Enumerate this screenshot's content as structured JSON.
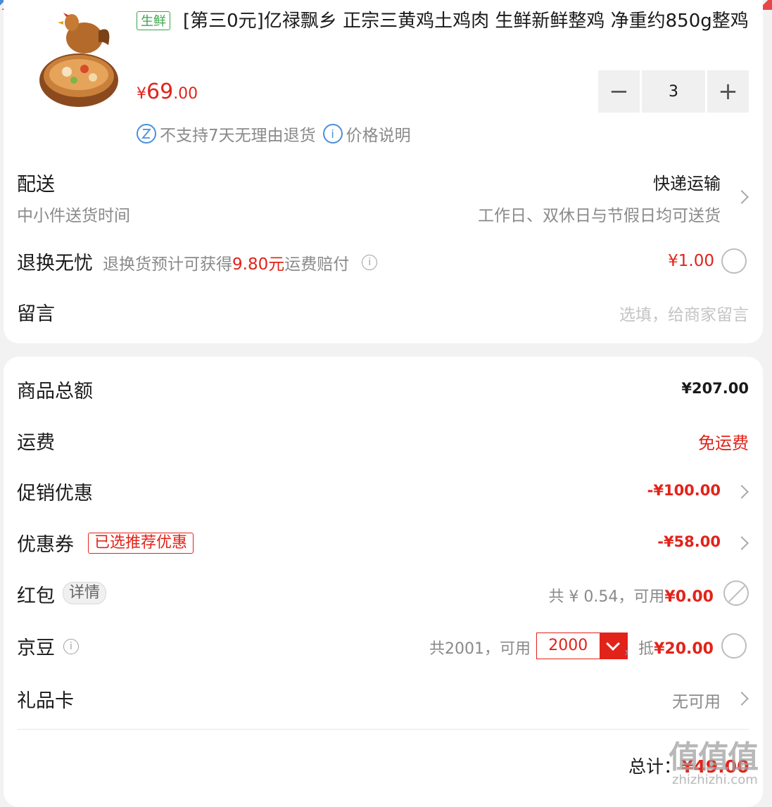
{
  "product": {
    "tag": "生鲜",
    "title": "[第三0元]亿禄飘乡 正宗三黄鸡土鸡肉 生鲜新鲜整鸡 净重约850g整鸡",
    "price_currency": "¥",
    "price_integer": "69",
    "price_decimal": ".00",
    "quantity": "3",
    "minus": "−",
    "plus": "+",
    "no_return_note": "不支持7天无理由退货",
    "price_note": "价格说明"
  },
  "delivery": {
    "label": "配送",
    "method": "快递运输",
    "time_label": "中小件送货时间",
    "time_value": "工作日、双休日与节假日均可送货"
  },
  "return_insurance": {
    "label": "退换无忧",
    "desc_prefix": "退换货预计可获得",
    "desc_amount": "9.80元",
    "desc_suffix": "运费赔付",
    "price": "¥1.00"
  },
  "message": {
    "label": "留言",
    "placeholder": "选填，给商家留言"
  },
  "summary": {
    "goods_total_label": "商品总额",
    "goods_total": "¥207.00",
    "shipping_label": "运费",
    "shipping_value": "免运费",
    "promo_label": "促销优惠",
    "promo_value": "-¥100.00",
    "coupon_label": "优惠券",
    "coupon_badge": "已选推荐优惠",
    "coupon_value": "-¥58.00",
    "redpack_label": "红包",
    "redpack_detail": "详情",
    "redpack_info": "共 ¥ 0.54，可用",
    "redpack_value": "¥0.00",
    "jdbean_label": "京豆",
    "jdbean_total": "共2001，可用",
    "jdbean_select": "2000",
    "jdbean_deduct_prefix": "，抵",
    "jdbean_deduct": "¥20.00",
    "giftcard_label": "礼品卡",
    "giftcard_value": "无可用",
    "total_label": "总计：",
    "total_value": "¥49.00"
  },
  "watermark": {
    "logo": "值值值",
    "site": "zhizhizhi.com"
  },
  "colors": {
    "accent": "#e2231a",
    "fresh_tag": "#3aa54a",
    "info_blue": "#4a90d9"
  }
}
